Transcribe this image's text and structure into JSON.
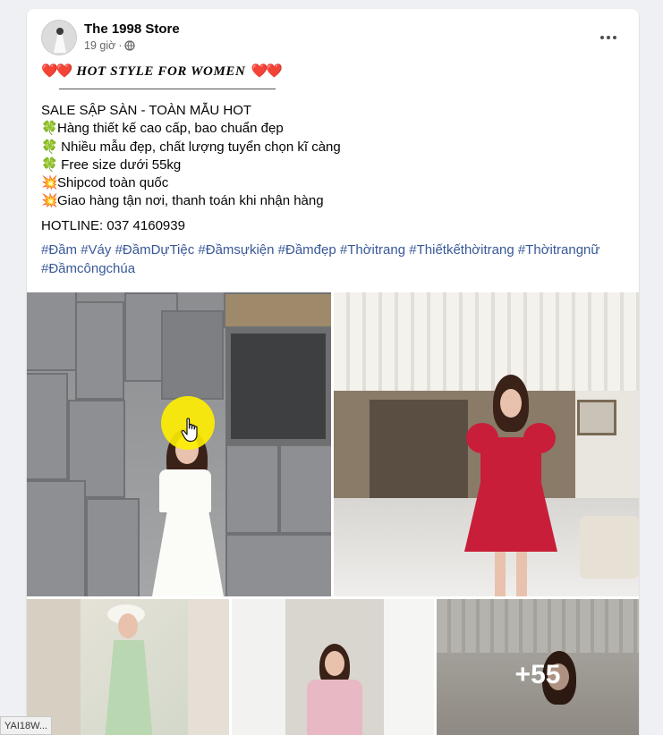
{
  "post": {
    "page_name": "The 1998 Store",
    "timestamp": "19 giờ",
    "privacy_icon": "globe-icon",
    "more_icon": "more-dots-icon",
    "title_hearts_left": "❤️❤️",
    "title": "HOT STYLE FOR WOMEN",
    "title_hearts_right": "❤️❤️",
    "lines": [
      {
        "emoji": "",
        "text": "SALE SẬP SÀN - TOÀN MẪU HOT"
      },
      {
        "emoji": "🍀",
        "text": "Hàng thiết kế cao cấp, bao chuẩn đẹp"
      },
      {
        "emoji": "🍀",
        "text": " Nhiều mẫu đẹp, chất lượng tuyển chọn kĩ càng"
      },
      {
        "emoji": "🍀",
        "text": " Free size dưới 55kg"
      },
      {
        "emoji": "💥",
        "text": "Shipcod toàn quốc"
      },
      {
        "emoji": "💥",
        "text": "Giao hàng tận nơi, thanh toán khi nhận hàng"
      }
    ],
    "hotline": "HOTLINE: 037 4160939",
    "hashtags": [
      "#Đầm",
      "#Váy",
      "#ĐầmDựTiệc",
      "#Đầmsựkiện",
      "#Đầmđẹp",
      "#Thờitrang",
      "#Thiếtkếthờitrang",
      "#Thờitrangnữ",
      "#Đầmcôngchúa"
    ],
    "more_photos_count": "+55"
  },
  "status_chip": "YAI18W...",
  "colors": {
    "link": "#385898",
    "cursor_highlight": "#ffee00",
    "heart": "#e0245e"
  }
}
